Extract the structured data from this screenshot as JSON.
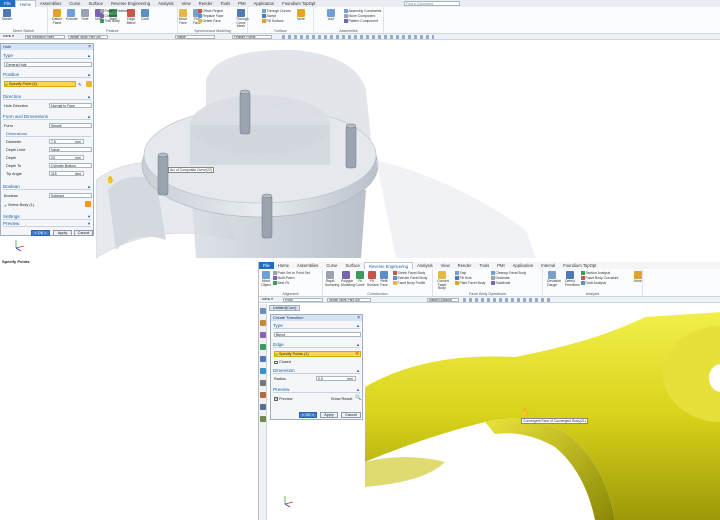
{
  "top": {
    "tabs": [
      "File",
      "Home",
      "Assemblies",
      "Curve",
      "Surface",
      "Reverse Engineering",
      "Analysis",
      "View",
      "Render",
      "Tools",
      "PMI",
      "Application",
      "Foundium TopOpt"
    ],
    "search_placeholder": "Find a Command",
    "groups": [
      "Direct Sketch",
      "Feature",
      "Synchronous Modeling",
      "Surface",
      "Assemblies"
    ],
    "buttons_big": [
      "Sketch",
      "Datum Plane",
      "Extrude",
      "Hole",
      "Unite",
      "Shell",
      "Edge Blend",
      "Draft",
      "Move Face",
      "Pull Face",
      "Through Curve Mesh",
      "More",
      "Add"
    ],
    "buttons_small": [
      "Pattern Feature",
      "Chamfer",
      "Trim Body",
      "Offset Region",
      "Replace Face",
      "Delete Face",
      "Through Curves",
      "Swept",
      "Fill Surface",
      "Assembly Constraints",
      "Move Component",
      "Pattern Component"
    ],
    "selbar": {
      "menu": "Menu ▾",
      "filter": "No Selection Filter",
      "scope": "Within Work Part Onl",
      "snap": "Inside",
      "points": "Feature Points"
    }
  },
  "hole_dialog": {
    "title": "Hole",
    "type_label": "Type",
    "type_value": "General Hole",
    "position_label": "Position",
    "specify_point": "Specify Point (4)",
    "direction_label": "Direction",
    "hole_direction_label": "Hole Direction",
    "hole_direction_value": "Normal to Face",
    "form_label": "Form and Dimensions",
    "form_row": "Form",
    "form_value": "Simple",
    "dimensions_label": "Dimensions",
    "diameter_label": "Diameter",
    "diameter_value": "7.5",
    "diameter_unit": "mm",
    "depth_limit_label": "Depth Limit",
    "depth_limit_value": "Value",
    "depth_label": "Depth",
    "depth_value": "20",
    "depth_unit": "mm",
    "depth_to_label": "Depth To",
    "depth_to_value": "Cylinder Bottom",
    "tip_angle_label": "Tip Angle",
    "tip_angle_value": "118",
    "tip_angle_unit": "deg",
    "boolean_section": "Boolean",
    "boolean_label": "Boolean",
    "boolean_value": "Subtract",
    "select_body": "Select Body (1)",
    "settings_label": "Settings",
    "preview_label": "Preview",
    "ok": "< OK >",
    "apply": "Apply",
    "cancel": "Cancel"
  },
  "top_tooltip": "Arc of Composite Curve(22)",
  "status_text": "Specify Points",
  "bottom": {
    "tabs": [
      "File",
      "Home",
      "Assemblies",
      "Curve",
      "Surface",
      "Reverse Engineering",
      "Analysis",
      "View",
      "Render",
      "Tools",
      "PMI",
      "Application",
      "Internal",
      "Foundium TopOpt"
    ],
    "groups": [
      "Alignment",
      "Construction",
      "Facet Body Operations",
      "Analysis"
    ],
    "buttons_big": [
      "Move Object",
      "Rapid Surfacing",
      "Polygon Modeling",
      "Fit Curve",
      "Fit Surface",
      "Refit Face",
      "Convert Facet Body",
      "Deviation Gauge",
      "Detect Primitives",
      "More"
    ],
    "buttons_small": [
      "Point Set to Point Set",
      "Multi-Patch",
      "Best Fit",
      "Shrink Facet Body",
      "Extrude Facet Body",
      "Facet Body Profile",
      "Snip",
      "Fill Hole",
      "Paint Facet Body",
      "Cleanup Facet Body",
      "Decimate",
      "Subdivide",
      "Section Analysis",
      "Facet Body Curvature",
      "Draft Analysis"
    ],
    "selbar": {
      "menu": "Menu ▾",
      "filter": "Point",
      "scope": "Within Work Part Onl",
      "snap": "Inside/Crossing"
    },
    "doc_tab": "Untitled(Curv)",
    "tooltip": "Convergent Face of Convergent Body(21)"
  },
  "transition_dialog": {
    "title": "Create Transition",
    "type_label": "Type",
    "type_value": "Blend",
    "edge_label": "Edge",
    "specify_points": "Specify Points (1)",
    "closed_label": "Closed",
    "dimension_label": "Dimension",
    "radius_label": "Radius",
    "radius_value": "0.5",
    "radius_unit": "mm",
    "preview_section": "Preview",
    "preview_label": "Preview",
    "show_result": "Show Result",
    "ok": "< OK >",
    "apply": "Apply",
    "cancel": "Cancel"
  }
}
